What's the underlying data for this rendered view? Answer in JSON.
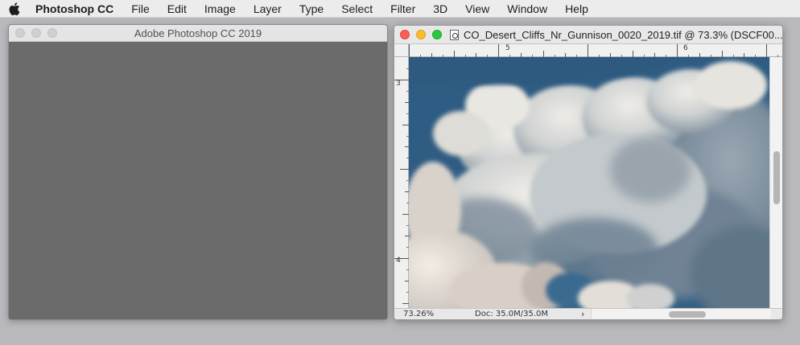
{
  "menubar": {
    "app_name": "Photoshop CC",
    "items": [
      "File",
      "Edit",
      "Image",
      "Layer",
      "Type",
      "Select",
      "Filter",
      "3D",
      "View",
      "Window",
      "Help"
    ]
  },
  "app_window": {
    "title": "Adobe Photoshop CC 2019"
  },
  "document_window": {
    "title": "CO_Desert_Cliffs_Nr_Gunnison_0020_2019.tif @ 73.3% (DSCF00...",
    "ruler_top_labels": [
      "5",
      "6"
    ],
    "ruler_left_labels": [
      "3",
      "4"
    ],
    "status": {
      "zoom": "73.26%",
      "doc_size": "Doc: 35.0M/35.0M",
      "arrow": "›"
    },
    "vertical_scroll_position": 0.4,
    "horizontal_scroll_position": 0.55
  },
  "colors": {
    "sky": "#3a6a91",
    "cloud_light": "#e6e4de",
    "cloud_shadow": "#7a8a98",
    "close": "#fc5f57",
    "minimize": "#fdbc2e",
    "zoom": "#29c840"
  },
  "icons": [
    "apple-icon",
    "document-icon"
  ]
}
